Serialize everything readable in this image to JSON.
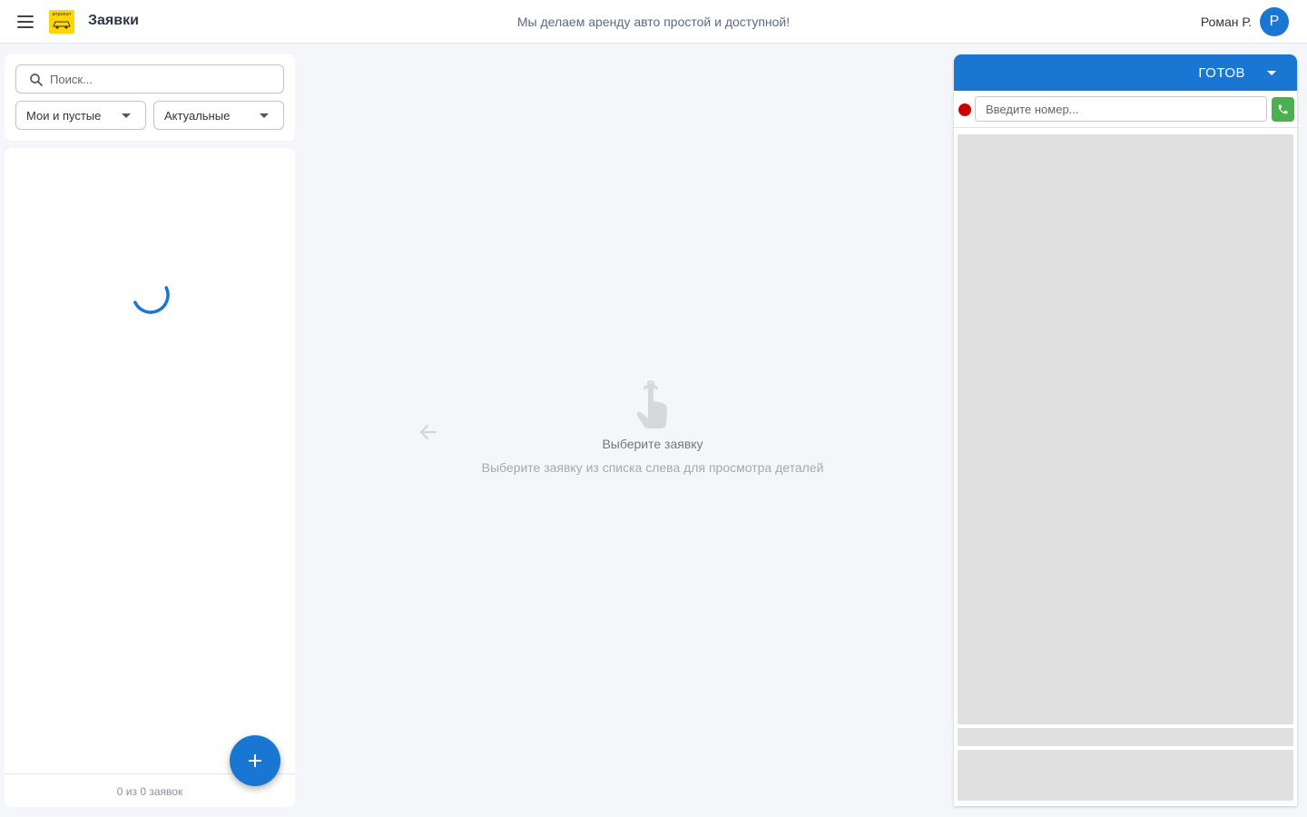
{
  "header": {
    "title": "Заявки",
    "slogan": "Мы делаем аренду авто простой и доступной!",
    "logo_text": "апрокат",
    "user_name": "Роман Р.",
    "avatar_letter": "Р"
  },
  "filters": {
    "search_placeholder": "Поиск...",
    "owner_filter": "Мои и пустые",
    "status_filter": "Актуальные"
  },
  "list": {
    "footer": "0 из 0 заявок",
    "loading": true
  },
  "empty_state": {
    "title": "Выберите заявку",
    "description": "Выберите заявку из списка слева для просмотра деталей"
  },
  "phone": {
    "status": "ГОТОВ",
    "input_placeholder": "Введите номер..."
  },
  "colors": {
    "primary": "#1976d2",
    "call_green": "#4caf50",
    "record_red": "#cc0000",
    "logo_yellow": "#ffd600"
  }
}
